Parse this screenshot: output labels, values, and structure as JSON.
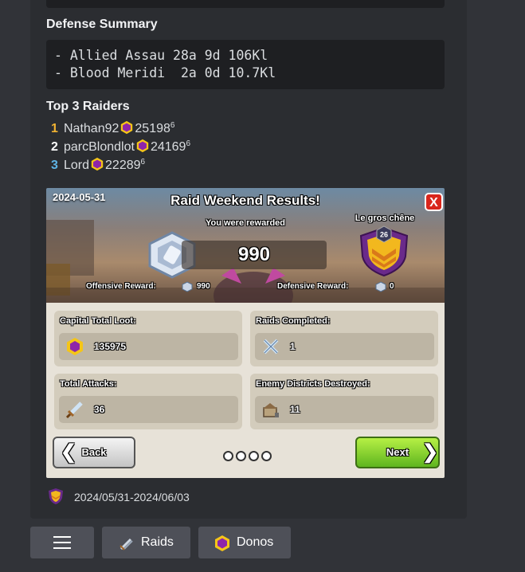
{
  "defense": {
    "title": "Defense Summary",
    "lines": [
      "- Allied Assau 28a 9d 106Kl",
      "- Blood Meridi  2a 0d 10.7Kl"
    ]
  },
  "raiders": {
    "title": "Top 3 Raiders",
    "items": [
      {
        "rank": "1",
        "name": "Nathan92",
        "value": "25198",
        "sup": "6",
        "rank_color": "#f0b232"
      },
      {
        "rank": "2",
        "name": "parcBlondlot",
        "value": "24169",
        "sup": "6",
        "rank_color": "#ffffff"
      },
      {
        "rank": "3",
        "name": "Lord",
        "value": "22289",
        "sup": "6",
        "rank_color": "#5eb4e6"
      }
    ]
  },
  "game": {
    "date": "2024-05-31",
    "title": "Raid Weekend Results!",
    "close": "X",
    "subtitle": "You were rewarded",
    "reward": "990",
    "clan_name": "Le gros chêne",
    "clan_level": "26",
    "offensive_label": "Offensive Reward:",
    "offensive_value": "990",
    "defensive_label": "Defensive Reward:",
    "defensive_value": "0",
    "cards": [
      {
        "label": "Capital Total Loot:",
        "value": "135975",
        "icon": "capital-gold-icon"
      },
      {
        "label": "Raids Completed:",
        "value": "1",
        "icon": "crossed-swords-icon"
      },
      {
        "label": "Total Attacks:",
        "value": "36",
        "icon": "sword-icon"
      },
      {
        "label": "Enemy Districts Destroyed:",
        "value": "11",
        "icon": "destroyed-building-icon"
      }
    ],
    "back": "Back",
    "next": "Next",
    "page_count": 4
  },
  "footer": {
    "date_range": "2024/05/31-2024/06/03"
  },
  "buttons": {
    "menu_icon": "hamburger-icon",
    "raids": "Raids",
    "donos": "Donos"
  },
  "colors": {
    "background": "#313338",
    "embed": "#2b2d31",
    "code": "#1e1f22",
    "button": "#4e5058",
    "gem_purple": "#8e24aa",
    "gem_gold": "#f5c518"
  }
}
